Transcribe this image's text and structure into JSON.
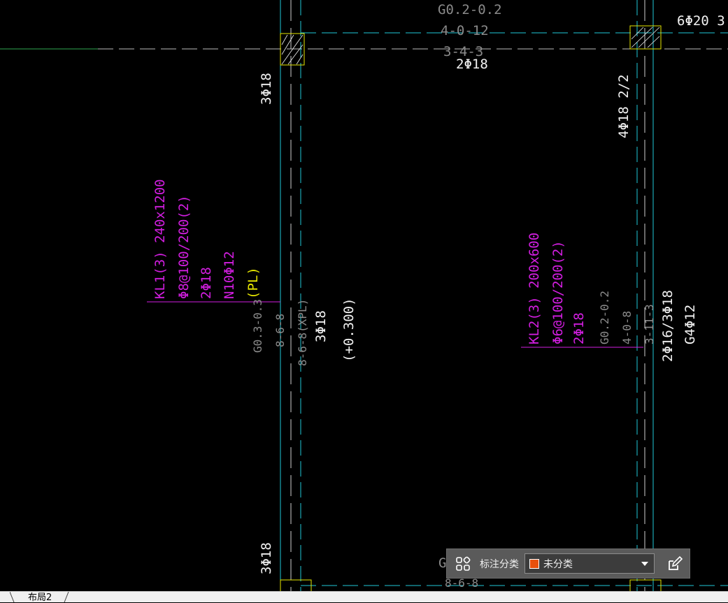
{
  "drawing": {
    "labels": {
      "top_gq": "G0.2-0.2",
      "top_412": "4-0-12",
      "top_343": "3-4-3",
      "top_2phi18": "2Φ18",
      "top_right": "6Φ20 3",
      "left_3phi18_top": "3Φ18",
      "left_3phi18_bottom": "3Φ18",
      "right_4phi18": "4Φ18 2/2",
      "kl1_line1": "KL1(3) 240x1200",
      "kl1_line2": "Φ8@100/200(2)",
      "kl1_line3": "2Φ18",
      "kl1_line4": "N10Φ12",
      "kl1_pl": "(PL)",
      "gq03": "G0.3-0.3",
      "g868": "8-6-8",
      "g868xpl": "8-6-8(XPL)",
      "mid_3phi18": "3Φ18",
      "elev": "(+0.300)",
      "kl2_line1": "KL2(3) 200x600",
      "kl2_line2": "Φ6@100/200(2)",
      "kl2_line3": "2Φ18",
      "kl2_gq": "G0.2-0.2",
      "kl2_408": "4-0-8",
      "kl2_3113": "3-11-3",
      "kl2_right1": "2Φ16/3Φ18",
      "kl2_right2": "G4Φ12",
      "bottom_g": "G",
      "bottom_868": "8-6-8"
    }
  },
  "annotation_toolbar": {
    "label": "标注分类",
    "selected_value": "未分类",
    "swatch_color": "#e8500d"
  },
  "tabs": {
    "layout2": "布局2"
  },
  "icons": {
    "grid": "grid-icon",
    "edit": "edit-icon",
    "dropdown": "chevron-down-icon"
  }
}
